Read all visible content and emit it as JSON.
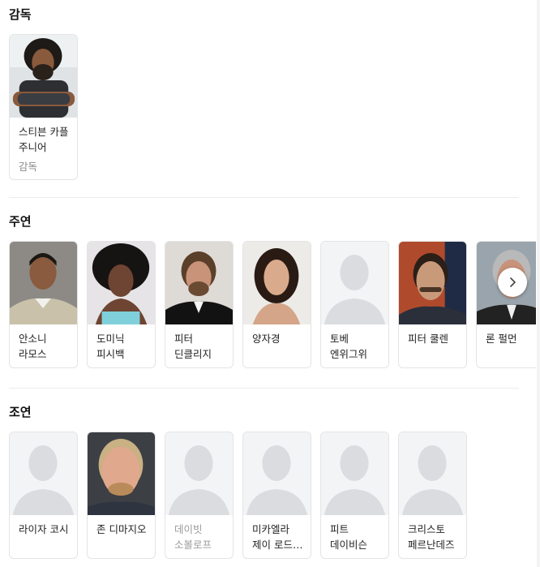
{
  "director": {
    "title": "감독",
    "people": [
      {
        "name": "스티븐 카플 주니어",
        "role": "감독",
        "photo": "person-director"
      }
    ]
  },
  "lead": {
    "title": "주연",
    "people": [
      {
        "name": "안소니 라모스",
        "photo": "person-a"
      },
      {
        "name": "도미닉 피시백",
        "photo": "person-b"
      },
      {
        "name": "피터 딘클리지",
        "photo": "person-c"
      },
      {
        "name": "양자경",
        "photo": "person-d"
      },
      {
        "name": "토베 엔위그위",
        "photo": "placeholder"
      },
      {
        "name": "피터 쿨렌",
        "photo": "person-e"
      },
      {
        "name": "론 펄먼",
        "photo": "person-f"
      }
    ],
    "next_icon": "chevron-right-icon"
  },
  "supporting": {
    "title": "조연",
    "people": [
      {
        "name": "라이자 코시",
        "photo": "placeholder"
      },
      {
        "name": "존 디마지오",
        "photo": "person-g"
      },
      {
        "name": "데이빗 소볼로프",
        "photo": "placeholder",
        "muted": true
      },
      {
        "name": "미카엘라 제이 로드…",
        "photo": "placeholder"
      },
      {
        "name": "피트 데이비슨",
        "photo": "placeholder"
      },
      {
        "name": "크리스토 페르난데즈",
        "photo": "placeholder"
      }
    ]
  }
}
